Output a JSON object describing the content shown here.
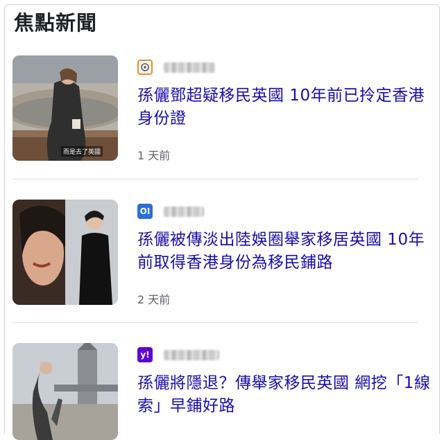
{
  "section": {
    "title": "焦點新聞"
  },
  "articles": [
    {
      "publisher_name": "publisher",
      "publisher_icon": "orange-outline-logo-icon",
      "headline": "孫儷鄧超疑移民英國 10年前已拎定香港身份證",
      "time": "1 天前",
      "thumb_caption": "而是去了英國"
    },
    {
      "publisher_name": "publisher",
      "publisher_icon": "blue-oi-logo-icon",
      "headline": "孫儷被傳淡出陸娛圈舉家移居英國 10年前取得香港身份為移民鋪路",
      "time": "2 天前"
    },
    {
      "publisher_name": "publisher",
      "publisher_icon": "yahoo-logo-icon",
      "headline": "孫儷將隱退？傳舉家移民英國 網挖「1線索」早鋪好路"
    }
  ],
  "colors": {
    "headline": "#1a0dab",
    "meta": "#5f6368",
    "yahoo": "#6001d2",
    "oi": "#2b6fd6",
    "hk01": "#f08a24"
  },
  "logos": {
    "oi_text": "OI",
    "yahoo_text": "y!"
  }
}
